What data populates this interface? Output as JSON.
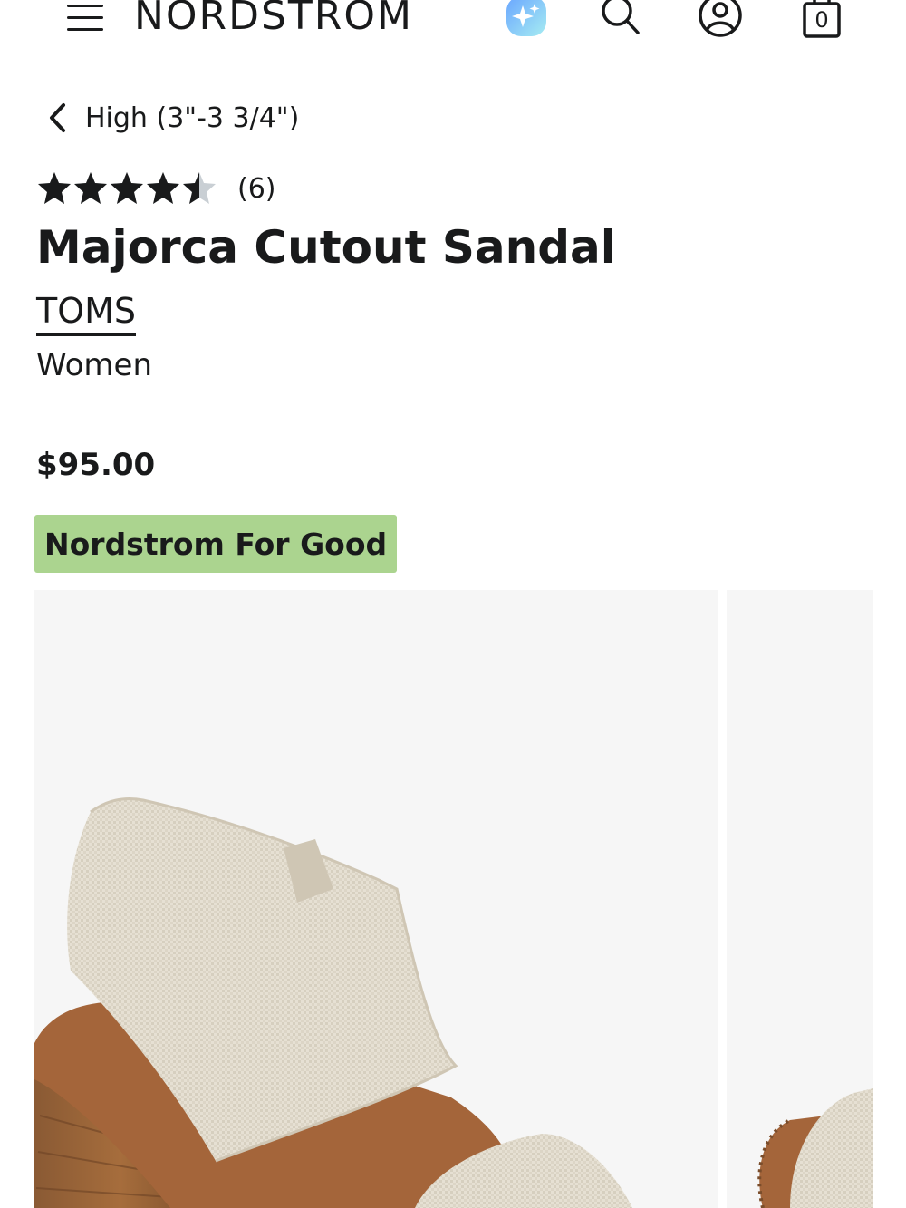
{
  "header": {
    "logo": "NORDSTROM",
    "bag_count": "0",
    "icons": [
      "menu-icon",
      "sparkle-ai-icon",
      "search-icon",
      "account-icon",
      "shopping-bag-icon"
    ]
  },
  "breadcrumb": {
    "label": "High (3\"-3 3/4\")"
  },
  "rating": {
    "value": 4.5,
    "max": 5,
    "review_count": "(6)"
  },
  "product": {
    "title": "Majorca Cutout Sandal",
    "brand": "TOMS",
    "category": "Women",
    "price": "$95.00",
    "badge": "Nordstrom For Good"
  },
  "colors": {
    "text": "#191a1b",
    "badge_bg": "#abd48f",
    "gallery_bg": "#f6f6f6",
    "ai_gradient_start": "#7fb3ff",
    "ai_gradient_end": "#9ee6f0"
  },
  "gallery": {
    "images": [
      {
        "subject": "sandal-main-image"
      },
      {
        "subject": "sandal-alt-image"
      }
    ]
  }
}
